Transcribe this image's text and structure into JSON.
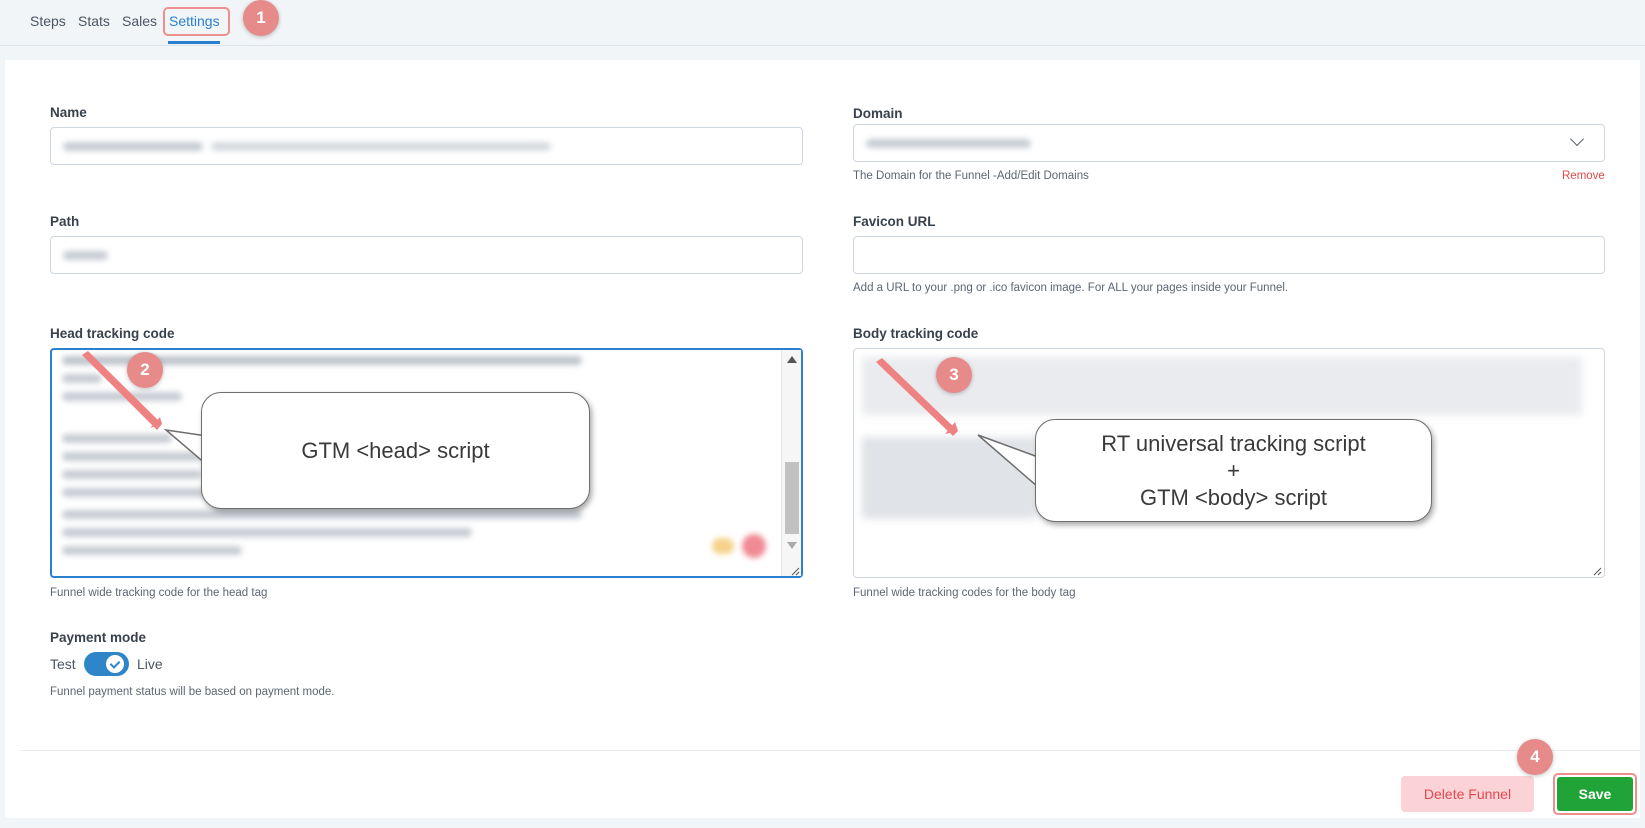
{
  "nav": {
    "tabs": [
      {
        "label": "Steps"
      },
      {
        "label": "Stats"
      },
      {
        "label": "Sales"
      },
      {
        "label": "Settings"
      }
    ]
  },
  "form": {
    "name": {
      "label": "Name"
    },
    "domain": {
      "label": "Domain",
      "help": "The Domain for the Funnel -Add/Edit Domains",
      "remove_label": "Remove"
    },
    "path": {
      "label": "Path"
    },
    "favicon": {
      "label": "Favicon URL",
      "value": "",
      "help": "Add a URL to your .png or .ico favicon image. For ALL your pages inside your Funnel."
    },
    "head_code": {
      "label": "Head tracking code",
      "help": "Funnel wide tracking code for the head tag"
    },
    "body_code": {
      "label": "Body tracking code",
      "help": "Funnel wide tracking codes for the body tag"
    },
    "payment_mode": {
      "label": "Payment mode",
      "left_label": "Test",
      "right_label": "Live",
      "selected": "Live",
      "help": "Funnel payment status will be based on payment mode."
    }
  },
  "annotations": {
    "callout_head": "GTM <head> script",
    "callout_body_line1": "RT universal tracking script",
    "callout_body_line2": "+",
    "callout_body_line3": "GTM <body> script",
    "badges": [
      "1",
      "2",
      "3",
      "4"
    ]
  },
  "actions": {
    "delete_label": "Delete Funnel",
    "save_label": "Save"
  },
  "colors": {
    "accent": "#2a7fd0",
    "toggle_on": "#2e86c9",
    "save": "#20a337",
    "delete_bg": "#fbd3d6",
    "delete_text": "#e04a52",
    "annotation": "#e68a8a"
  }
}
